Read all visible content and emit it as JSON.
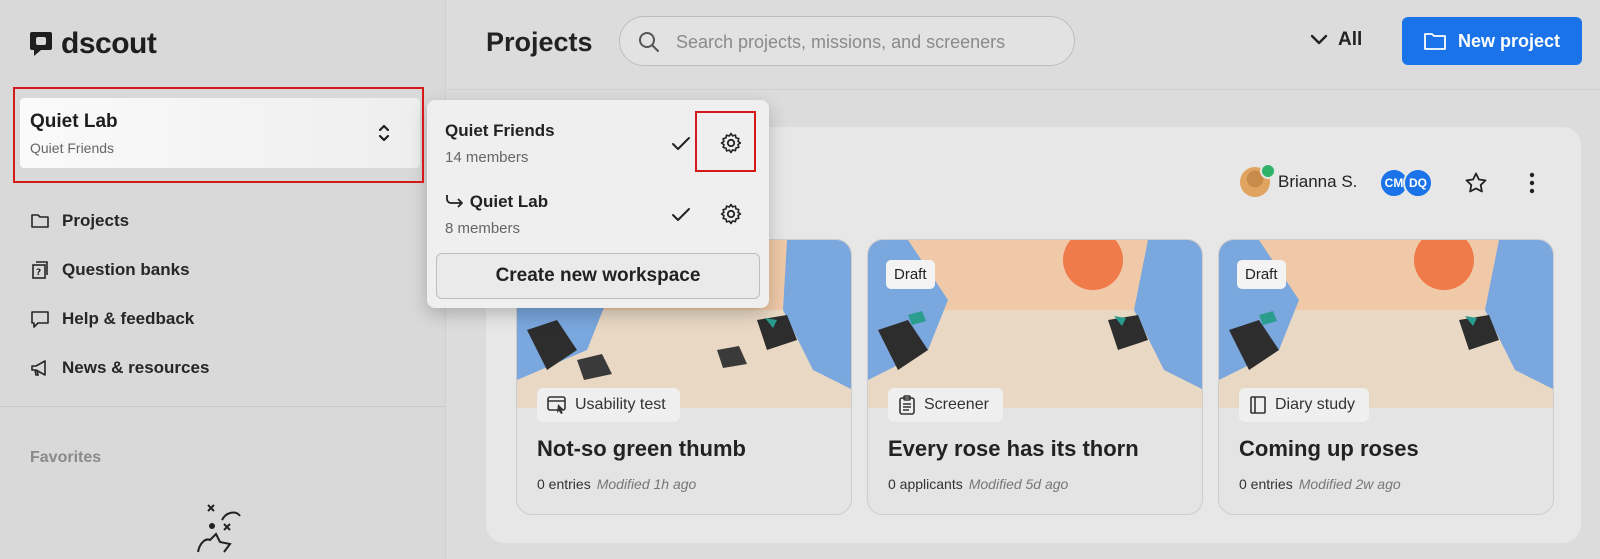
{
  "brand": {
    "name": "dscout"
  },
  "workspace_switcher": {
    "name": "Quiet Lab",
    "parent": "Quiet Friends"
  },
  "sidebar": {
    "items": [
      {
        "label": "Projects",
        "icon": "folder-icon"
      },
      {
        "label": "Question banks",
        "icon": "question-bank-icon"
      },
      {
        "label": "Help & feedback",
        "icon": "chat-bubble-icon"
      },
      {
        "label": "News & resources",
        "icon": "megaphone-icon"
      }
    ],
    "favorites_label": "Favorites"
  },
  "header": {
    "title": "Projects",
    "search_placeholder": "Search projects, missions, and screeners",
    "filter_label": "All",
    "new_project_label": "New project"
  },
  "workspace_dropdown": {
    "items": [
      {
        "name": "Quiet Friends",
        "members": "14 members",
        "selected": true
      },
      {
        "name": "Quiet Lab",
        "members": "8 members",
        "selected": true,
        "sub_workspace": true
      }
    ],
    "create_label": "Create new workspace"
  },
  "panel": {
    "owner": "Brianna S.",
    "members": [
      "CM",
      "DQ"
    ]
  },
  "cards": [
    {
      "badge": "",
      "type": "Usability test",
      "type_icon": "browser-cursor-icon",
      "title": "Not-so green thumb",
      "count": "0 entries",
      "modified": "Modified 1h ago"
    },
    {
      "badge": "Draft",
      "type": "Screener",
      "type_icon": "clipboard-icon",
      "title": "Every rose has its thorn",
      "count": "0 applicants",
      "modified": "Modified 5d ago"
    },
    {
      "badge": "Draft",
      "type": "Diary study",
      "type_icon": "book-icon",
      "title": "Coming up roses",
      "count": "0 entries",
      "modified": "Modified 2w ago"
    }
  ],
  "colors": {
    "accent": "#1a73e8",
    "highlight": "#d51919",
    "success": "#2fb36b"
  }
}
